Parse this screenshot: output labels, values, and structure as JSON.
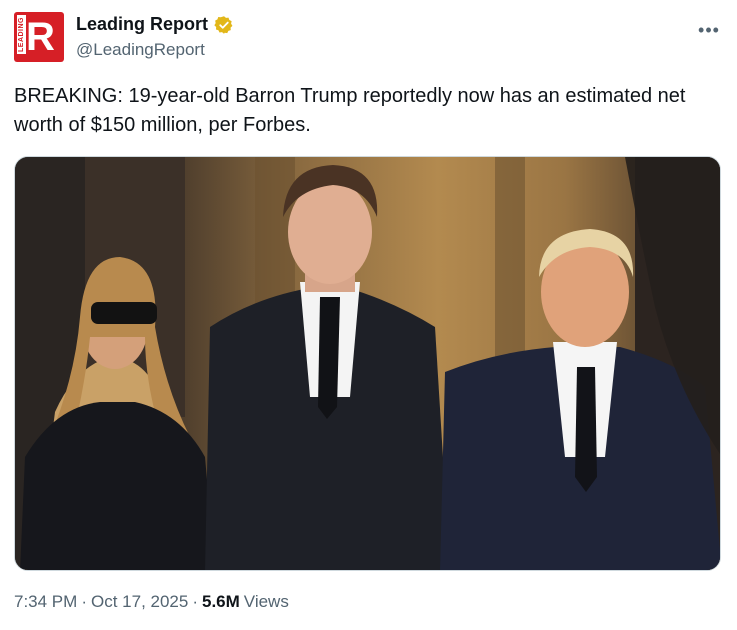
{
  "author": {
    "name": "Leading Report",
    "handle": "@LeadingReport",
    "avatar_letter": "R",
    "avatar_side_text": "LEADING",
    "verified_color": "#e2b719",
    "brand_color": "#d61f26"
  },
  "tweet": {
    "text": "BREAKING: 19-year-old Barron Trump reportedly now has an estimated net worth of $150 million, per Forbes.",
    "more_icon": "more-horizontal-icon"
  },
  "meta": {
    "time": "7:34 PM",
    "separator": "·",
    "date": "Oct 17, 2025",
    "views_count": "5.6M",
    "views_label": "Views"
  }
}
